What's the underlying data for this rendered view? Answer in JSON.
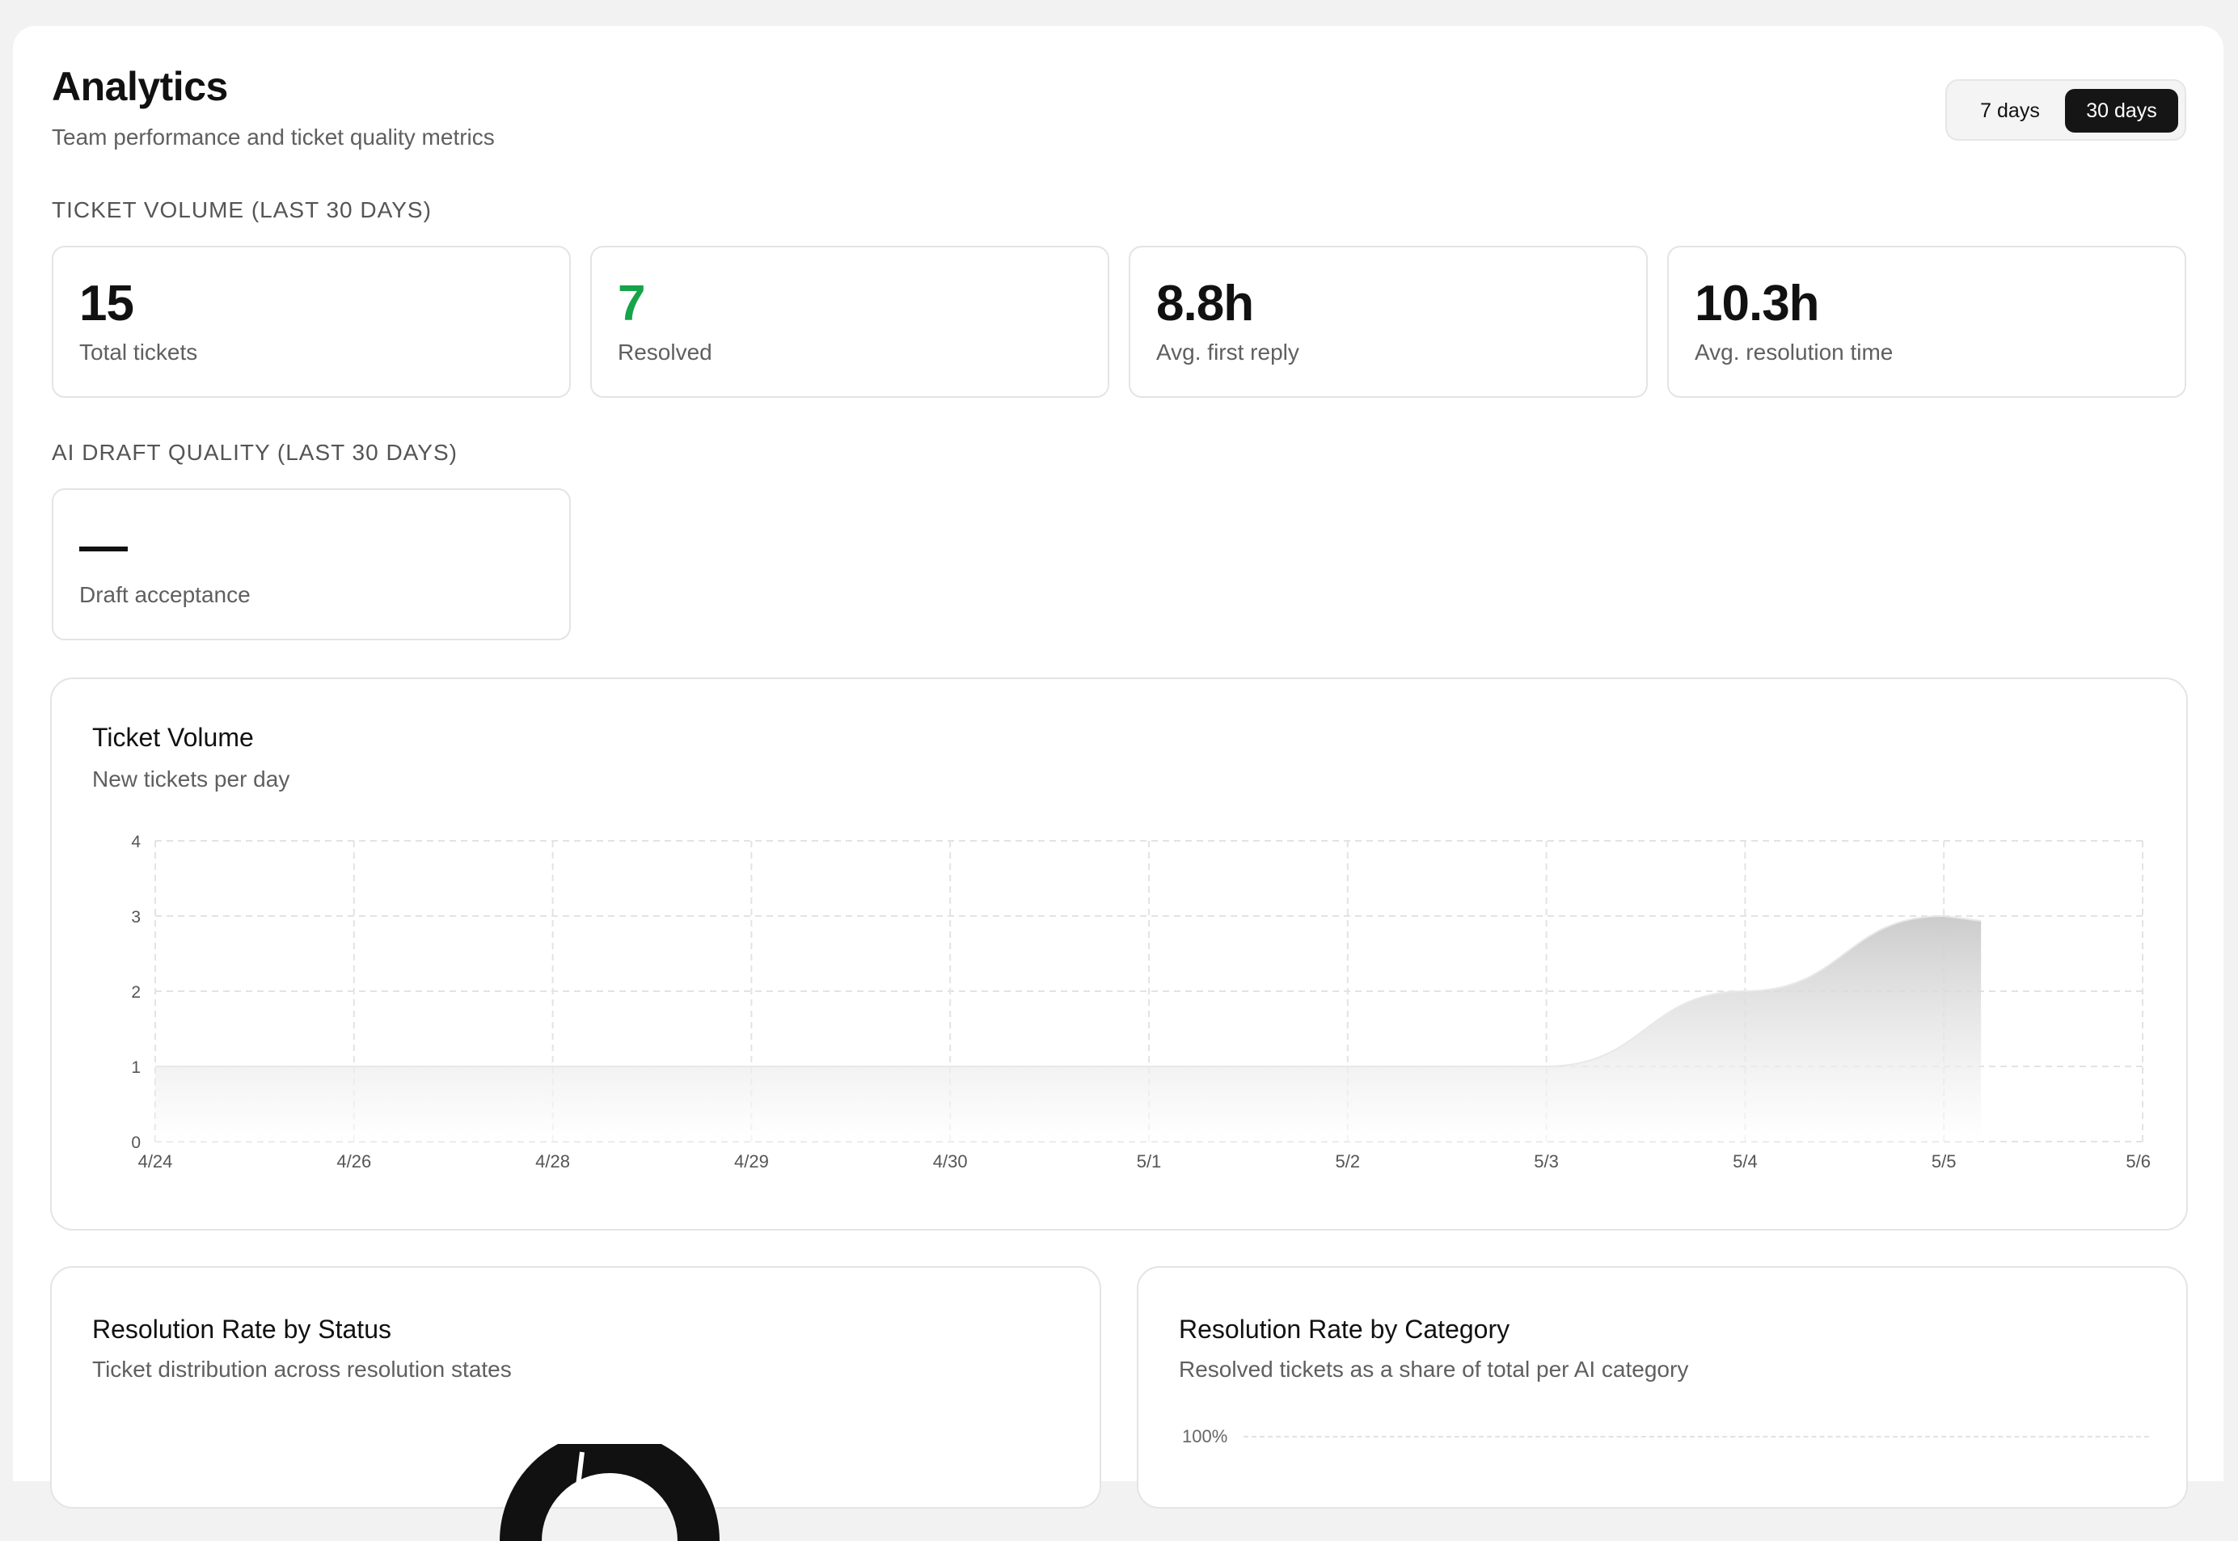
{
  "header": {
    "title": "Analytics",
    "subtitle": "Team performance and ticket quality metrics"
  },
  "range_toggle": {
    "options": [
      "7 days",
      "30 days"
    ],
    "selected": "30 days"
  },
  "ticket_volume_section": {
    "label": "TICKET VOLUME (LAST 30 DAYS)",
    "metrics": [
      {
        "value": "15",
        "label": "Total tickets"
      },
      {
        "value": "7",
        "label": "Resolved"
      },
      {
        "value": "8.8h",
        "label": "Avg. first reply"
      },
      {
        "value": "10.3h",
        "label": "Avg. resolution time"
      }
    ]
  },
  "ai_quality_section": {
    "label": "AI DRAFT QUALITY (LAST 30 DAYS)",
    "metric": {
      "value": "—",
      "label": "Draft acceptance"
    }
  },
  "volume_card": {
    "title": "Ticket Volume",
    "subtitle": "New tickets per day"
  },
  "status_card": {
    "title": "Resolution Rate by Status",
    "subtitle": "Ticket distribution across resolution states"
  },
  "category_card": {
    "title": "Resolution Rate by Category",
    "subtitle": "Resolved tickets as a share of total per AI category",
    "axis_top_label": "100%"
  },
  "colors": {
    "resolved_value": "#16a34a",
    "toggle_selected_bg": "#151515",
    "area_fill_top": "#cfcfcf"
  },
  "chart_data": {
    "type": "area",
    "title": "Ticket Volume",
    "subtitle": "New tickets per day",
    "x": [
      "4/24",
      "4/26",
      "4/28",
      "4/29",
      "4/30",
      "5/1",
      "5/2",
      "5/3",
      "5/4",
      "5/5",
      "5/6"
    ],
    "series": [
      {
        "values": [
          1,
          1,
          1,
          1,
          1,
          1,
          1,
          1,
          2,
          3,
          null
        ]
      }
    ],
    "ylim": [
      0,
      4
    ],
    "yticks": [
      0,
      1,
      2,
      3,
      4
    ],
    "grid": true,
    "legend": "none"
  }
}
